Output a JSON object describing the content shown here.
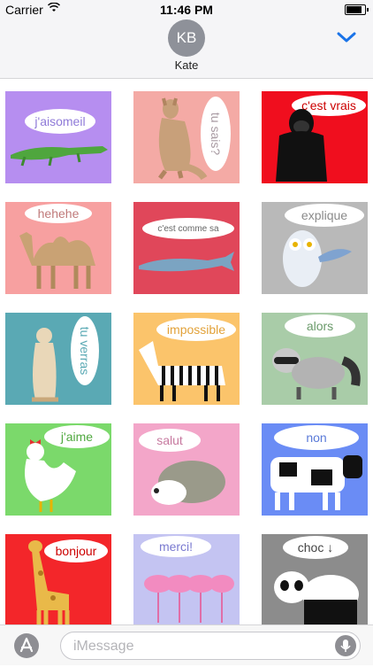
{
  "status": {
    "carrier": "Carrier",
    "time": "11:46 PM"
  },
  "contact": {
    "initials": "KB",
    "name": "Kate"
  },
  "stickers": [
    {
      "label": "j'aisomeil",
      "animal": "crocodile",
      "bg": "#b68ef0"
    },
    {
      "label": "tu sais?",
      "animal": "kangaroo",
      "bg": "#f4aaa5"
    },
    {
      "label": "c'est vrais",
      "animal": "gorilla",
      "bg": "#f00e1e"
    },
    {
      "label": "hehehe",
      "animal": "camel",
      "bg": "#f7a0a0"
    },
    {
      "label": "c'est comme sa",
      "animal": "whale",
      "bg": "#e0475a"
    },
    {
      "label": "explique",
      "animal": "owl",
      "bg": "#b9b9b9"
    },
    {
      "label": "tu verras",
      "animal": "meerkat",
      "bg": "#5aa9b4"
    },
    {
      "label": "impossible",
      "animal": "zebra",
      "bg": "#fbc46b"
    },
    {
      "label": "alors",
      "animal": "raccoon",
      "bg": "#a9cca8"
    },
    {
      "label": "j'aime",
      "animal": "rooster",
      "bg": "#7bd96b"
    },
    {
      "label": "salut",
      "animal": "hedgehog",
      "bg": "#f3a6c9"
    },
    {
      "label": "non",
      "animal": "cow",
      "bg": "#6a8cf5"
    },
    {
      "label": "bonjour",
      "animal": "giraffe",
      "bg": "#f3262a"
    },
    {
      "label": "merci!",
      "animal": "flamingos",
      "bg": "#c4c4f2"
    },
    {
      "label": "choc ↓",
      "animal": "panda",
      "bg": "#8c8c8c"
    }
  ],
  "input": {
    "placeholder": "iMessage"
  },
  "icons": {
    "collapse": "chevron-down-icon",
    "apps": "app-store-icon",
    "mic": "microphone-icon",
    "wifi": "wifi-icon",
    "battery": "battery-icon"
  }
}
